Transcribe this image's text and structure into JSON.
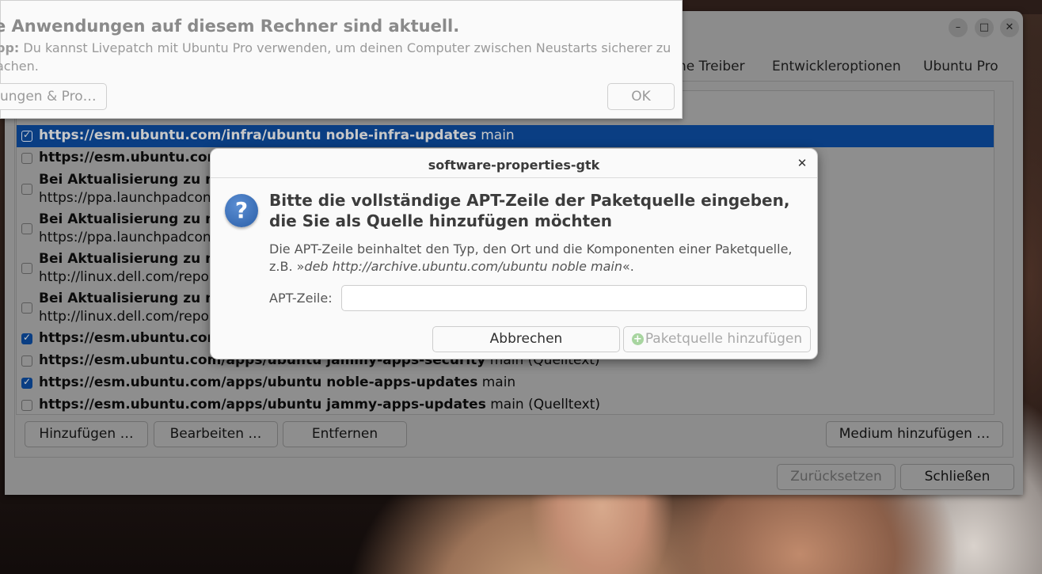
{
  "main_window": {
    "tabs": [
      "ne Treiber",
      "Entwickleroptionen",
      "Ubuntu Pro"
    ],
    "rows": [
      {
        "checked": true,
        "selected": true,
        "title": "https://esm.ubuntu.com/infra/ubuntu noble-infra-updates",
        "suffix": " main",
        "sub": ""
      },
      {
        "checked": false,
        "selected": false,
        "title": "https://esm.ubuntu.com",
        "suffix": "",
        "sub": ""
      },
      {
        "checked": false,
        "selected": false,
        "title": "Bei Aktualisierung zu no",
        "suffix": "",
        "sub": "https://ppa.launchpadcon"
      },
      {
        "checked": false,
        "selected": false,
        "title": "Bei Aktualisierung zu no",
        "suffix": "",
        "sub": "https://ppa.launchpadcon"
      },
      {
        "checked": false,
        "selected": false,
        "title": "Bei Aktualisierung zu no",
        "suffix": "",
        "sub": "http://linux.dell.com/repo"
      },
      {
        "checked": false,
        "selected": false,
        "title": "Bei Aktualisierung zu no",
        "suffix": "",
        "sub": "http://linux.dell.com/repo"
      },
      {
        "checked": true,
        "selected": false,
        "title": "https://esm.ubuntu.com",
        "suffix": "",
        "sub": ""
      },
      {
        "checked": false,
        "selected": false,
        "title": "https://esm.ubuntu.com/apps/ubuntu jammy-apps-security",
        "suffix": " main (Quelltext)",
        "sub": ""
      },
      {
        "checked": true,
        "selected": false,
        "title": "https://esm.ubuntu.com/apps/ubuntu noble-apps-updates",
        "suffix": " main",
        "sub": ""
      },
      {
        "checked": false,
        "selected": false,
        "title": "https://esm.ubuntu.com/apps/ubuntu jammy-apps-updates",
        "suffix": " main (Quelltext)",
        "sub": ""
      }
    ],
    "buttons": {
      "add": "Hinzufügen …",
      "edit": "Bearbeiten …",
      "remove": "Entfernen",
      "medium": "Medium hinzufügen …",
      "reset": "Zurücksetzen",
      "close": "Schließen"
    }
  },
  "notification": {
    "title": "e Anwendungen auf diesem Rechner sind aktuell.",
    "tip_label": "pp:",
    "tip_text": " Du kannst Livepatch mit Ubuntu Pro verwenden, um deinen Computer zwischen Neustarts sicherer zu",
    "tip_text2": "achen.",
    "button_update": "ungen & Pro…",
    "button_ok": "OK"
  },
  "dialog": {
    "title": "software-properties-gtk",
    "heading": "Bitte die vollständige APT-Zeile der Paketquelle eingeben, die Sie als Quelle hinzufügen möchten",
    "desc_text": "Die APT-Zeile beinhaltet den Typ, den Ort und die Komponenten einer Paketquelle, z.B. »",
    "desc_example": "deb http://archive.ubuntu.com/ubuntu noble main",
    "desc_end": "«.",
    "label": "APT-Zeile:",
    "input_value": "",
    "cancel": "Abbrechen",
    "add": "Paketquelle hinzufügen"
  }
}
